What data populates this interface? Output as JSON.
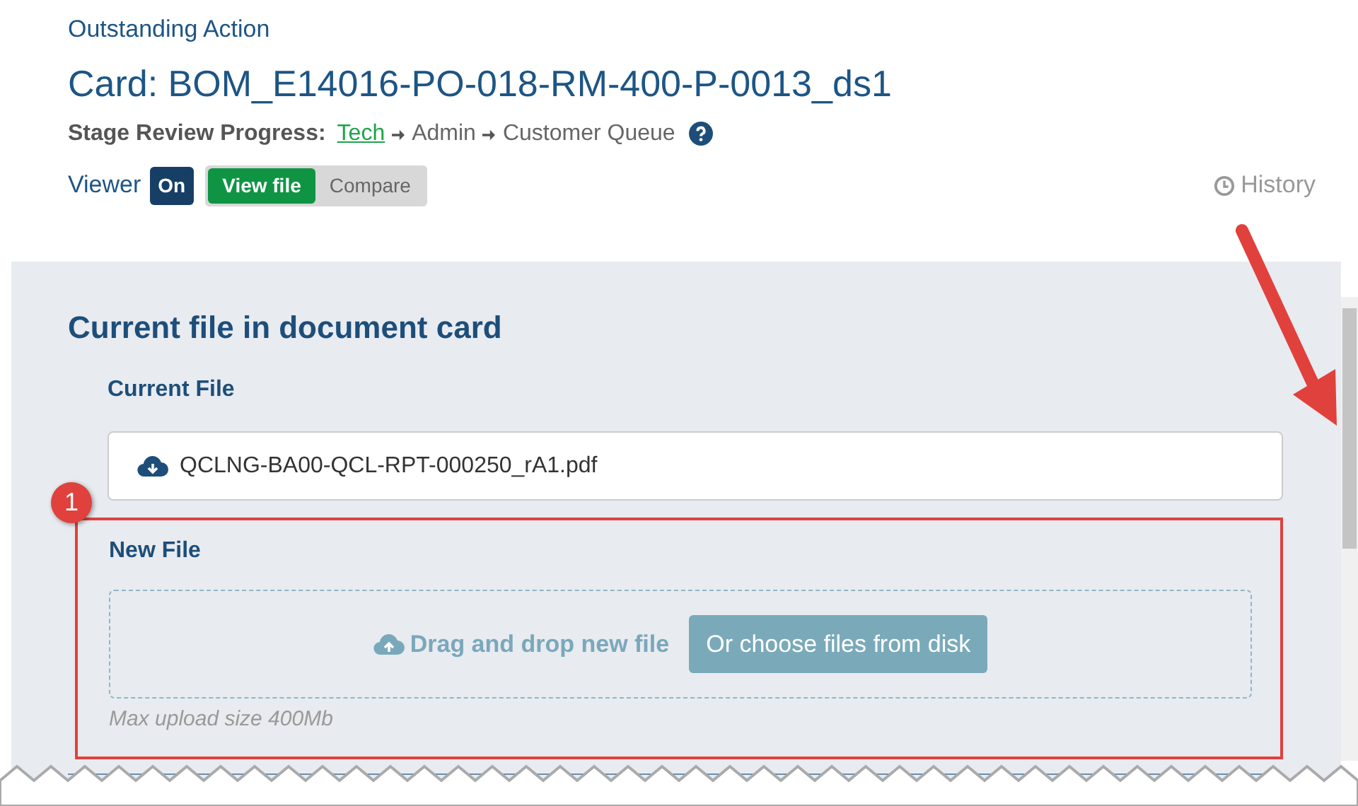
{
  "header": {
    "overline": "Outstanding Action",
    "title": "Card: BOM_E14016-PO-018-RM-400-P-0013_ds1"
  },
  "stage_progress": {
    "label": "Stage Review Progress:",
    "steps": [
      {
        "label": "Tech",
        "current": true
      },
      {
        "label": "Admin",
        "current": false
      },
      {
        "label": "Customer Queue",
        "current": false
      }
    ]
  },
  "viewer": {
    "label": "Viewer",
    "toggle": "On",
    "on": true,
    "modes": [
      {
        "label": "View file",
        "selected": true
      },
      {
        "label": "Compare",
        "selected": false
      }
    ]
  },
  "history": "History",
  "panel": {
    "heading": "Current file in document card",
    "current_file": {
      "label": "Current File",
      "filename": "QCLNG-BA00-QCL-RPT-000250_rA1.pdf"
    },
    "new_file": {
      "label": "New File",
      "drop_text": "Drag and drop new file",
      "button": "Or choose files from disk",
      "hint": "Max upload size 400Mb"
    }
  },
  "annotation": {
    "number": "1"
  }
}
